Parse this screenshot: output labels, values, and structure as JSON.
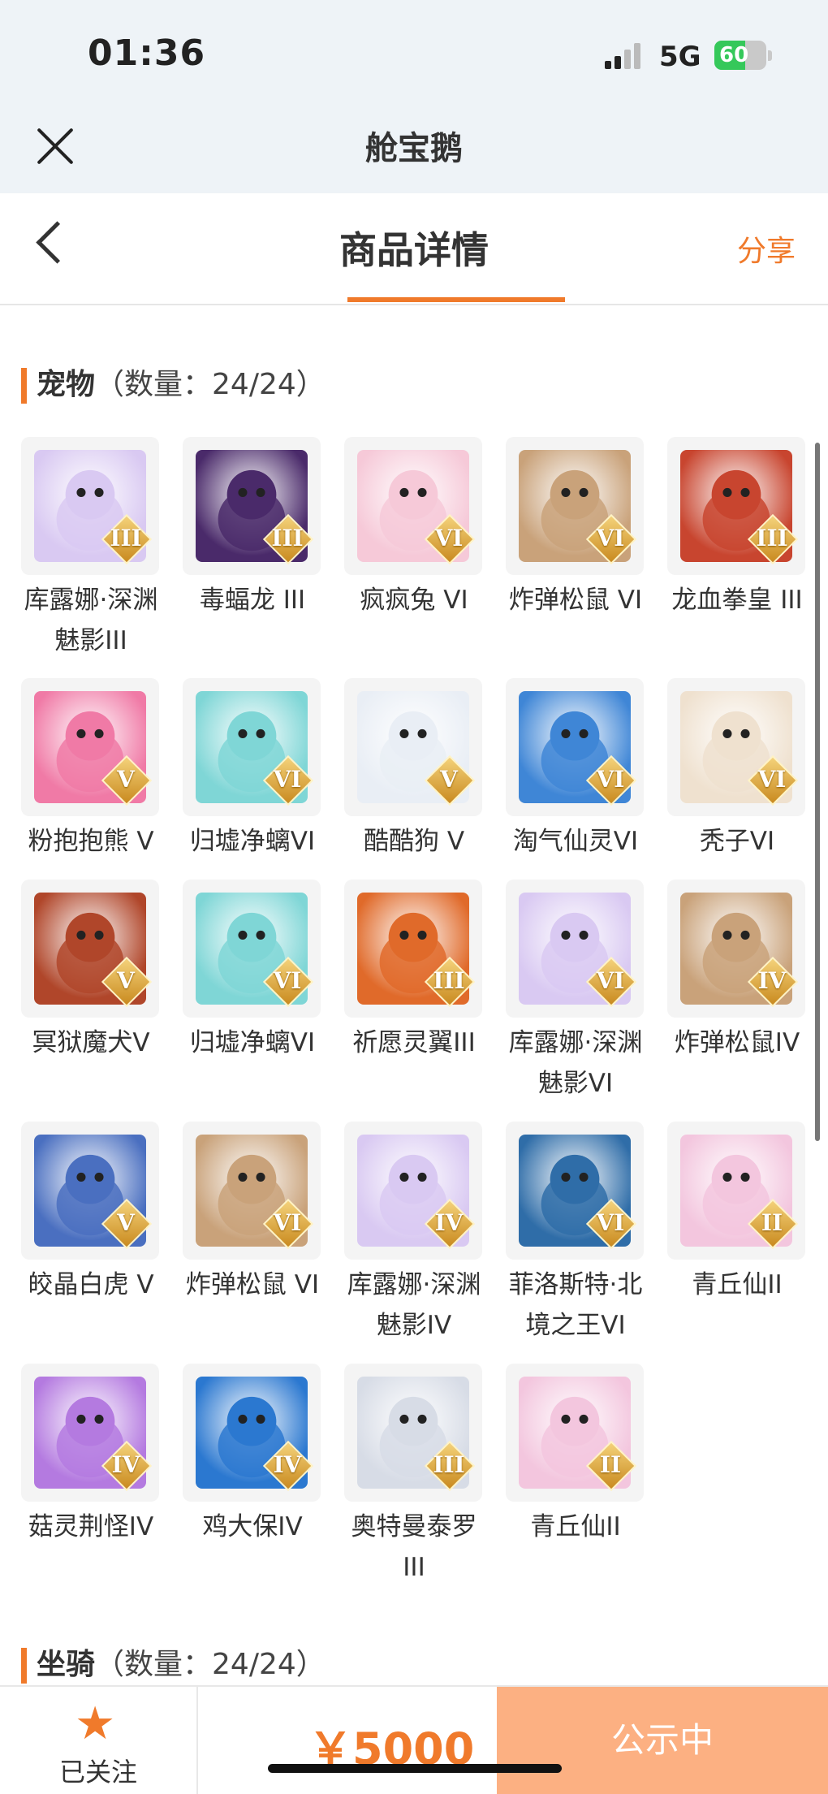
{
  "status": {
    "time": "01:36",
    "network": "5G",
    "battery": "60"
  },
  "app": {
    "title": "舱宝鹅"
  },
  "nav": {
    "title": "商品详情",
    "share": "分享"
  },
  "pets_section": {
    "title": "宠物",
    "count": "（数量：24/24）"
  },
  "pets": [
    {
      "name": "库露娜·深渊魅影III",
      "level": "III",
      "color": "#d9c9f2"
    },
    {
      "name": "毒蝠龙 III",
      "level": "III",
      "color": "#4a2a6a"
    },
    {
      "name": "疯疯兔 VI",
      "level": "VI",
      "color": "#f6c9d8"
    },
    {
      "name": "炸弹松鼠 VI",
      "level": "VI",
      "color": "#c9a27a"
    },
    {
      "name": "龙血拳皇 III",
      "level": "III",
      "color": "#c8452f"
    },
    {
      "name": "粉抱抱熊 V",
      "level": "V",
      "color": "#f07aa6"
    },
    {
      "name": "归墟净螭VI",
      "level": "VI",
      "color": "#7fd6d6"
    },
    {
      "name": "酷酷狗 V",
      "level": "V",
      "color": "#e9eef5"
    },
    {
      "name": "淘气仙灵VI",
      "level": "VI",
      "color": "#3f86d6"
    },
    {
      "name": "秃子VI",
      "level": "VI",
      "color": "#efe1cf"
    },
    {
      "name": "冥狱魔犬V",
      "level": "V",
      "color": "#b0462a"
    },
    {
      "name": "归墟净螭VI",
      "level": "VI",
      "color": "#7fd6d6"
    },
    {
      "name": "祈愿灵翼III",
      "level": "III",
      "color": "#e06a2a"
    },
    {
      "name": "库露娜·深渊魅影VI",
      "level": "VI",
      "color": "#d9c9f2"
    },
    {
      "name": "炸弹松鼠IV",
      "level": "IV",
      "color": "#c9a27a"
    },
    {
      "name": "皎晶白虎 V",
      "level": "V",
      "color": "#4a6fc0"
    },
    {
      "name": "炸弹松鼠 VI",
      "level": "VI",
      "color": "#c9a27a"
    },
    {
      "name": "库露娜·深渊魅影IV",
      "level": "IV",
      "color": "#d9c9f2"
    },
    {
      "name": "菲洛斯特·北境之王VI",
      "level": "VI",
      "color": "#2f6da8"
    },
    {
      "name": "青丘仙II",
      "level": "II",
      "color": "#f3c6de"
    },
    {
      "name": "菇灵荆怪IV",
      "level": "IV",
      "color": "#b47ae0"
    },
    {
      "name": "鸡大保IV",
      "level": "IV",
      "color": "#2b78d0"
    },
    {
      "name": "奥特曼泰罗III",
      "level": "III",
      "color": "#d7dce6"
    },
    {
      "name": "青丘仙II",
      "level": "II",
      "color": "#f3c6de"
    }
  ],
  "mounts_section": {
    "title": "坐骑",
    "count": "（数量：24/24）"
  },
  "footer": {
    "follow_label": "已关注",
    "price": "￥5000",
    "status": "公示中"
  },
  "colors": {
    "accent": "#f07a2b",
    "status_button": "#fcb082"
  }
}
